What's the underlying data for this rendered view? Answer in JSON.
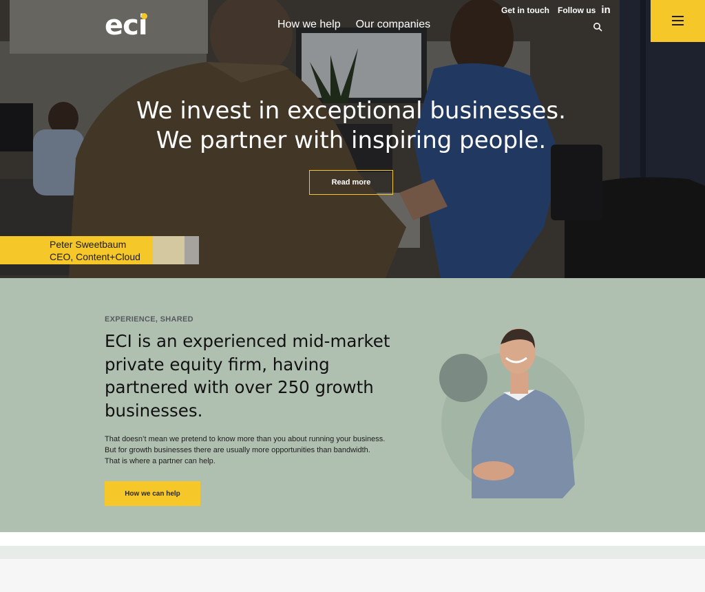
{
  "brand": {
    "logo_text": "eci",
    "accent_color": "#f6c728"
  },
  "nav": {
    "main": [
      {
        "label": "How we help"
      },
      {
        "label": "Our companies"
      }
    ],
    "top": {
      "get_in_touch": "Get in touch",
      "follow_us": "Follow us",
      "linkedin_text": "in"
    },
    "search_icon": "search-icon",
    "menu_icon": "hamburger-icon"
  },
  "hero": {
    "headline_line1": "We invest in exceptional businesses.",
    "headline_line2": "We partner with inspiring people.",
    "cta_label": "Read more",
    "caption_name": "Peter Sweetbaum",
    "caption_role": "CEO, Content+Cloud"
  },
  "about": {
    "eyebrow": "EXPERIENCE, SHARED",
    "title": "ECI is an experienced mid-market private equity firm, having partnered with over 250 growth businesses.",
    "body": "That doesn’t mean we pretend to know more than you about running your business. But for growth businesses there are usually more opportunities than bandwidth. That is where a partner can help.",
    "cta_label": "How we can help",
    "background_color": "#b0c0b0"
  }
}
